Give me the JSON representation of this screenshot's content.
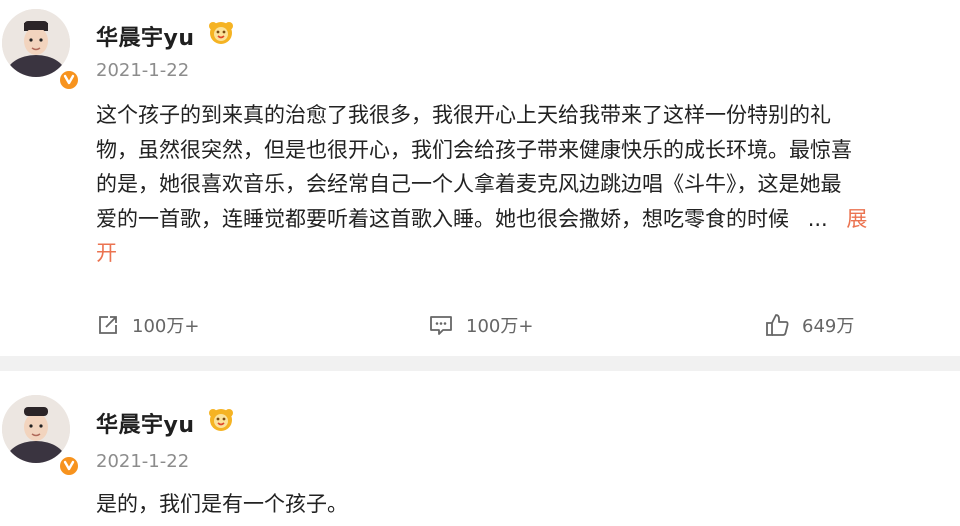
{
  "posts": [
    {
      "author": "华晨宇yu",
      "date": "2021-1-22",
      "lines": [
        "这个孩子的到来真的治愈了我很多，我很开心上天给我带来了这样一份特别的礼",
        "物，虽然很突然，但是也很开心，我们会给孩子带来健康快乐的成长环境。最惊喜",
        "的是，她很喜欢音乐，会经常自己一个人拿着麦克风边跳边唱《斗牛》，这是她最",
        "爱的一首歌，连睡觉都要听着这首歌入睡。她也很会撒娇，想吃零食的时候"
      ],
      "ellipsis": "...",
      "more_label_1": "展",
      "more_label_2": "开",
      "actions": {
        "repost": "100万+",
        "comment": "100万+",
        "like": "649万"
      },
      "icons": [
        "avatar",
        "verified-icon",
        "fan-badge-icon",
        "repost-icon",
        "comment-icon",
        "like-icon"
      ]
    },
    {
      "author": "华晨宇yu",
      "date": "2021-1-22",
      "text": "是的，我们是有一个孩子。"
    }
  ],
  "colors": {
    "accent_more": "#eb7350",
    "verified": "#f7931e",
    "divider": "#f1f1f1"
  }
}
